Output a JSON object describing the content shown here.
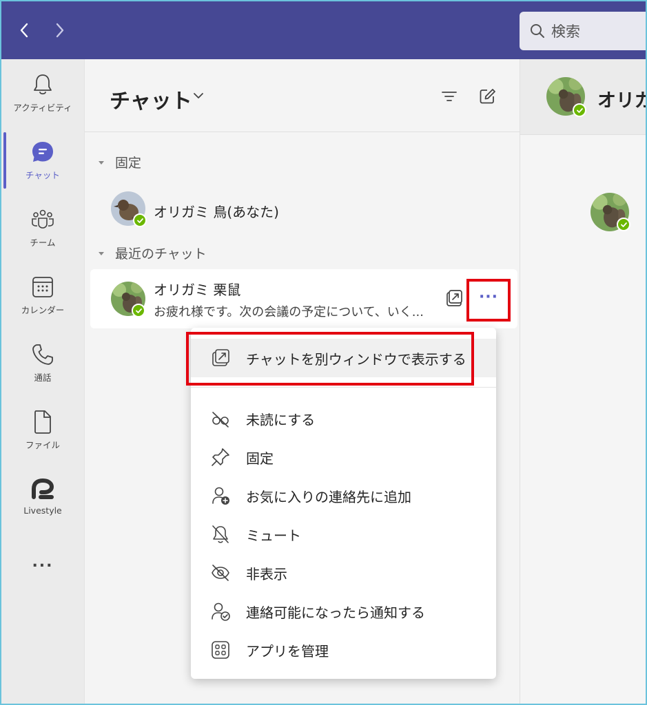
{
  "titlebar": {
    "search_placeholder": "検索"
  },
  "rail": {
    "items": [
      {
        "label": "アクティビティ",
        "icon": "bell-icon"
      },
      {
        "label": "チャット",
        "icon": "chat-icon"
      },
      {
        "label": "チーム",
        "icon": "teams-icon"
      },
      {
        "label": "カレンダー",
        "icon": "calendar-icon"
      },
      {
        "label": "通話",
        "icon": "phone-icon"
      },
      {
        "label": "ファイル",
        "icon": "file-icon"
      },
      {
        "label": "Livestyle",
        "icon": "livestyle-icon"
      }
    ],
    "more": "..."
  },
  "chatpane": {
    "title": "チャット",
    "sections": {
      "pinned": "固定",
      "recent": "最近のチャット"
    },
    "pinned_chat": {
      "name": "オリガミ 鳥(あなた)"
    },
    "recent_chat": {
      "name": "オリガミ 栗鼠",
      "preview": "お疲れ様です。次の会議の予定について、いく...",
      "more": "···"
    }
  },
  "menu": {
    "items": [
      {
        "label": "チャットを別ウィンドウで表示する",
        "icon": "popout-icon"
      },
      {
        "label": "未読にする",
        "icon": "unread-icon"
      },
      {
        "label": "固定",
        "icon": "pin-icon"
      },
      {
        "label": "お気に入りの連絡先に追加",
        "icon": "add-contact-icon"
      },
      {
        "label": "ミュート",
        "icon": "mute-icon"
      },
      {
        "label": "非表示",
        "icon": "hide-icon"
      },
      {
        "label": "連絡可能になったら通知する",
        "icon": "notify-available-icon"
      },
      {
        "label": "アプリを管理",
        "icon": "manage-apps-icon"
      }
    ]
  },
  "conversation": {
    "name": "オリガ"
  },
  "colors": {
    "titlebar": "#464894",
    "accent": "#5b5fc7",
    "presence": "#6bb700",
    "highlight_box": "#e3000f"
  }
}
